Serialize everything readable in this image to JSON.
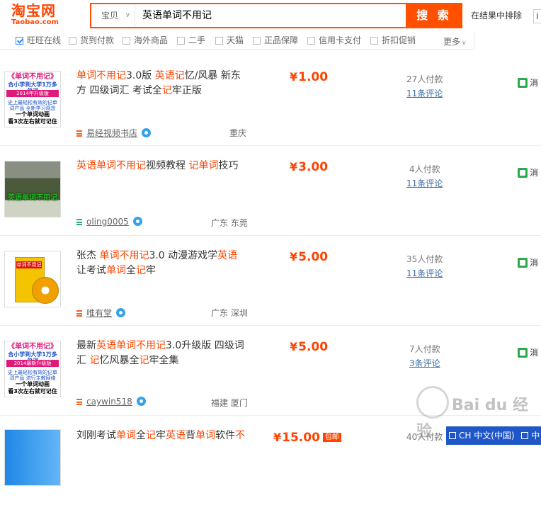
{
  "header": {
    "logo_main": "淘宝网",
    "logo_sub": "Taobao.com",
    "search_type": "宝贝",
    "search_query": "英语单词不用记",
    "search_button": "搜 索",
    "exclude_label": "在结果中排除",
    "exclude_value": "i"
  },
  "filters": {
    "items": [
      {
        "label": "旺旺在线",
        "checked": true
      },
      {
        "label": "货到付款",
        "checked": false
      },
      {
        "label": "海外商品",
        "checked": false
      },
      {
        "label": "二手",
        "checked": false
      },
      {
        "label": "天猫",
        "checked": false
      },
      {
        "label": "正品保障",
        "checked": false
      },
      {
        "label": "信用卡支付",
        "checked": false
      },
      {
        "label": "折扣促销",
        "checked": false
      }
    ],
    "more": "更多"
  },
  "items": [
    {
      "title_parts": [
        {
          "t": "单词不用记",
          "hl": true
        },
        {
          "t": "3.0版 ",
          "hl": false
        },
        {
          "t": "英语记",
          "hl": true
        },
        {
          "t": "忆/风暴 新东方 四级词汇 考试全",
          "hl": false
        },
        {
          "t": "记",
          "hl": true
        },
        {
          "t": "牢正版",
          "hl": false
        }
      ],
      "price": "1.00",
      "yen": "¥",
      "sales": "27人付款",
      "reviews": "11条评论",
      "seller": "易经视频书店",
      "location": "重庆",
      "service": "消",
      "thumb": {
        "a": "《单词不用记》",
        "b": "合小学到大学1万多单词",
        "c": "2014年升级版",
        "d": "史上最轻松有效的记单词产品 全新学习观念",
        "e": "一个单词动画",
        "f": "看3次左右就可记住"
      }
    },
    {
      "title_parts": [
        {
          "t": "英语单词不用记",
          "hl": true
        },
        {
          "t": "视频教程 ",
          "hl": false
        },
        {
          "t": "记单词",
          "hl": true
        },
        {
          "t": "技巧",
          "hl": false
        }
      ],
      "price": "3.00",
      "yen": "¥",
      "sales": "4人付款",
      "reviews": "11条评论",
      "seller": "oling0005",
      "location": "广东 东莞",
      "service": "消",
      "thumb_caption": "英语单词不用记"
    },
    {
      "title_parts": [
        {
          "t": "张杰 ",
          "hl": false
        },
        {
          "t": "单词不用记",
          "hl": true
        },
        {
          "t": "3.0 动漫游戏学",
          "hl": false
        },
        {
          "t": "英语",
          "hl": true
        },
        {
          "t": " 让考试",
          "hl": false
        },
        {
          "t": "单词",
          "hl": true
        },
        {
          "t": "全",
          "hl": false
        },
        {
          "t": "记",
          "hl": true
        },
        {
          "t": "牢",
          "hl": false
        }
      ],
      "price": "5.00",
      "yen": "¥",
      "sales": "35人付款",
      "reviews": "11条评论",
      "seller": "唯有堂",
      "location": "广东 深圳",
      "service": "消",
      "thumb_label": "单词不用记"
    },
    {
      "title_parts": [
        {
          "t": "最新",
          "hl": false
        },
        {
          "t": "英语单词不用记",
          "hl": true
        },
        {
          "t": "3.0升级版 四级词汇 ",
          "hl": false
        },
        {
          "t": "记",
          "hl": true
        },
        {
          "t": "忆风暴全",
          "hl": false
        },
        {
          "t": "记",
          "hl": true
        },
        {
          "t": "牢全集",
          "hl": false
        }
      ],
      "price": "5.00",
      "yen": "¥",
      "sales": "7人付款",
      "reviews": "3条评论",
      "seller": "caywin518",
      "location": "福建 厦门",
      "service": "消",
      "thumb": {
        "a": "《单词不用记》",
        "b": "合小学到大学1万多单词",
        "c": "2014最新升级版",
        "d": "史上最轻松有效的记单词产品 流行主教网络",
        "e": "一个单词动画",
        "f": "看3次左右就可记住"
      }
    },
    {
      "title_parts": [
        {
          "t": "刘刚考试",
          "hl": false
        },
        {
          "t": "单词",
          "hl": true
        },
        {
          "t": "全",
          "hl": false
        },
        {
          "t": "记",
          "hl": true
        },
        {
          "t": "牢",
          "hl": false
        },
        {
          "t": "英语",
          "hl": true
        },
        {
          "t": "背",
          "hl": false
        },
        {
          "t": "单词",
          "hl": true
        },
        {
          "t": "软件",
          "hl": false
        },
        {
          "t": "不",
          "hl": true
        }
      ],
      "price": "15.00",
      "yen": "¥",
      "free_shipping": "包邮",
      "sales": "40人付款"
    }
  ],
  "watermark": {
    "text": "Bai du 经验"
  },
  "ime": {
    "text": "CH 中文(中国)",
    "extra": "中"
  },
  "colors": {
    "accent": "#ff5000",
    "highlight": "#ff4400",
    "link": "#3c6ea8"
  }
}
